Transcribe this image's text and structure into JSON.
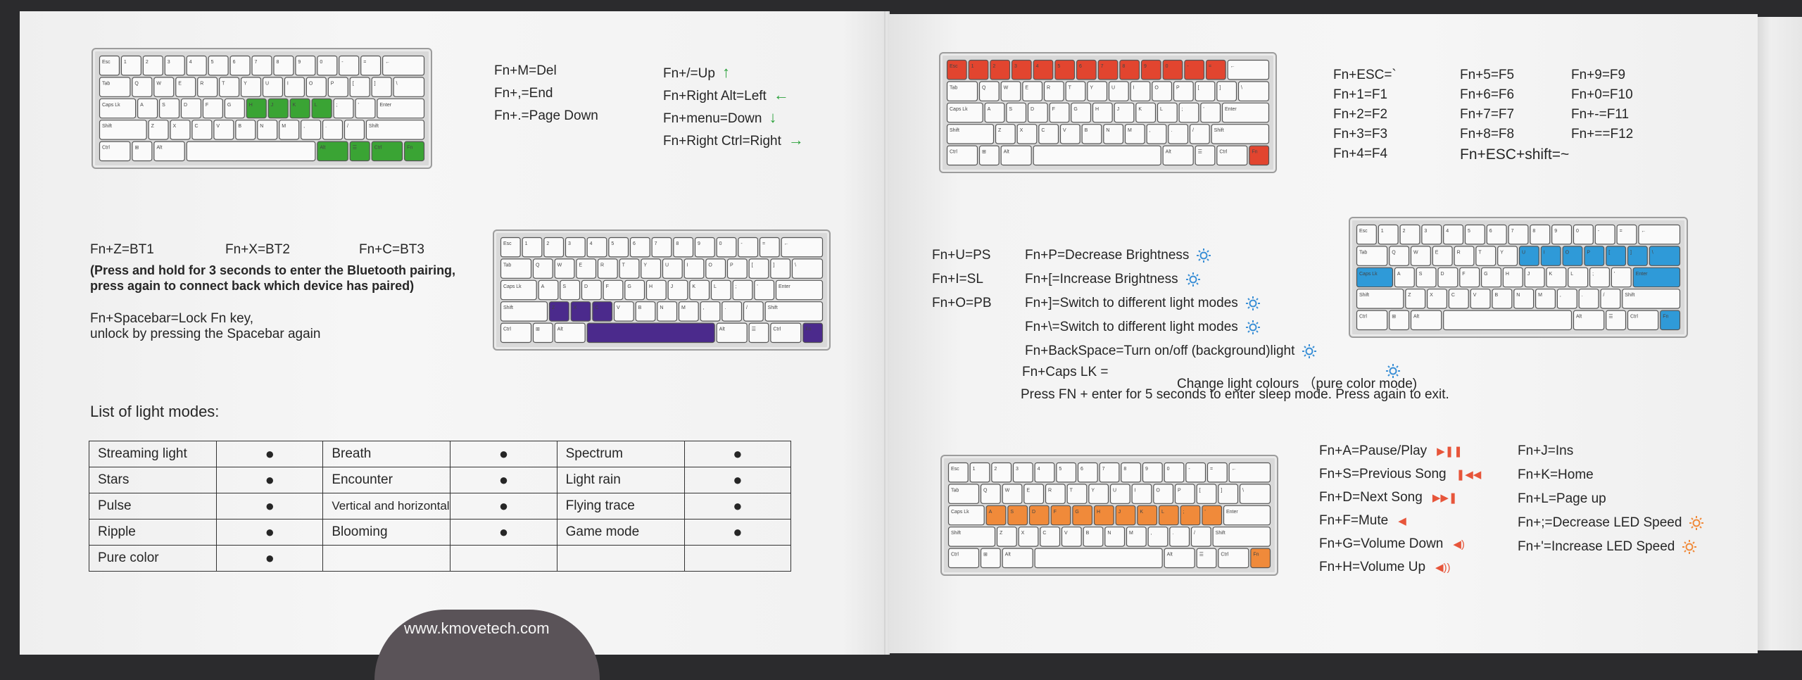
{
  "left": {
    "shortcuts_col1": [
      "Fn+M=Del",
      "Fn+,=End",
      "Fn+.=Page Down"
    ],
    "shortcuts_col2": [
      {
        "text": "Fn+/=Up",
        "arrow": "↑"
      },
      {
        "text": "Fn+Right Alt=Left",
        "arrow": "←"
      },
      {
        "text": "Fn+menu=Down",
        "arrow": "↓"
      },
      {
        "text": "Fn+Right Ctrl=Right",
        "arrow": "→"
      }
    ],
    "bt": [
      "Fn+Z=BT1",
      "Fn+X=BT2",
      "Fn+C=BT3"
    ],
    "bt_note_1": "(Press and hold for 3 seconds to enter the Bluetooth pairing,",
    "bt_note_2": "press again to connect back which device has paired)",
    "lock_1": "Fn+Spacebar=Lock Fn key,",
    "lock_2": "unlock by pressing the Spacebar again",
    "modes_title": "List of light modes:",
    "modes": [
      [
        "Streaming light",
        "Breath",
        "Spectrum"
      ],
      [
        "Stars",
        "Encounter",
        "Light rain"
      ],
      [
        "Pulse",
        "Vertical and horizontal",
        "Flying trace"
      ],
      [
        "Ripple",
        "Blooming",
        "Game mode"
      ],
      [
        "Pure color",
        "",
        ""
      ]
    ],
    "dot": "●",
    "url": "www.kmovetech.com"
  },
  "right": {
    "fkeys": [
      [
        "Fn+ESC=`",
        "Fn+5=F5",
        "Fn+9=F9"
      ],
      [
        "Fn+1=F1",
        "Fn+6=F6",
        "Fn+0=F10"
      ],
      [
        "Fn+2=F2",
        "Fn+7=F7",
        "Fn+-=F11"
      ],
      [
        "Fn+3=F3",
        "Fn+8=F8",
        "Fn+==F12"
      ],
      [
        "Fn+4=F4",
        "Fn+ESC+shift=~",
        ""
      ]
    ],
    "modes_left": [
      "Fn+U=PS",
      "Fn+I=SL",
      "Fn+O=PB"
    ],
    "light": [
      "Fn+P=Decrease Brightness",
      "Fn+[=Increase Brightness",
      "Fn+]=Switch to different light modes",
      "Fn+\\=Switch to different light modes",
      "Fn+BackSpace=Turn on/off (background)light"
    ],
    "caps": "Fn+Caps LK =",
    "caps_desc": "Change light colours （pure color mode)",
    "sleep": "Press FN + enter for 5 seconds to enter sleep mode. Press again to exit.",
    "media_left": [
      {
        "text": "Fn+A=Pause/Play",
        "icon": "▶❚❚"
      },
      {
        "text": "Fn+S=Previous Song",
        "icon": "❚◀◀"
      },
      {
        "text": "Fn+D=Next Song",
        "icon": "▶▶❚"
      },
      {
        "text": "Fn+F=Mute",
        "icon": "◀"
      },
      {
        "text": "Fn+G=Volume Down",
        "icon": "◀)"
      },
      {
        "text": "Fn+H=Volume Up",
        "icon": "◀))"
      }
    ],
    "media_right": [
      "Fn+J=Ins",
      "Fn+K=Home",
      "Fn+L=Page up",
      "Fn+;=Decrease LED Speed",
      "Fn+'=Increase LED Speed"
    ]
  },
  "colors": {
    "green": "#3aa434",
    "purple": "#4b2a8c",
    "red": "#e2452f",
    "blue": "#2f9ad8",
    "orange": "#f08a3a",
    "key": "#fafafa"
  }
}
